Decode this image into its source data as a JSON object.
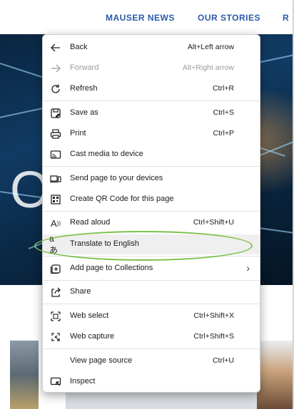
{
  "page": {
    "nav": [
      "MAUSER NEWS",
      "OUR STORIES",
      "R"
    ]
  },
  "menu": {
    "items": [
      {
        "label": "Back",
        "shortcut": "Alt+Left arrow",
        "icon": "arrow-left-icon"
      },
      {
        "label": "Forward",
        "shortcut": "Alt+Right arrow",
        "icon": "arrow-right-icon",
        "disabled": true
      },
      {
        "label": "Refresh",
        "shortcut": "Ctrl+R",
        "icon": "refresh-icon"
      },
      {
        "label": "Save as",
        "shortcut": "Ctrl+S",
        "icon": "save-icon"
      },
      {
        "label": "Print",
        "shortcut": "Ctrl+P",
        "icon": "print-icon"
      },
      {
        "label": "Cast media to device",
        "shortcut": "",
        "icon": "cast-icon"
      },
      {
        "label": "Send page to your devices",
        "shortcut": "",
        "icon": "devices-icon"
      },
      {
        "label": "Create QR Code for this page",
        "shortcut": "",
        "icon": "qr-code-icon"
      },
      {
        "label": "Read aloud",
        "shortcut": "Ctrl+Shift+U",
        "icon": "read-aloud-icon"
      },
      {
        "label": "Translate to English",
        "shortcut": "",
        "icon": "translate-icon"
      },
      {
        "label": "Add page to Collections",
        "shortcut": "",
        "icon": "collections-icon"
      },
      {
        "label": "Share",
        "shortcut": "",
        "icon": "share-icon"
      },
      {
        "label": "Web select",
        "shortcut": "Ctrl+Shift+X",
        "icon": "web-select-icon"
      },
      {
        "label": "Web capture",
        "shortcut": "Ctrl+Shift+S",
        "icon": "web-capture-icon"
      },
      {
        "label": "View page source",
        "shortcut": "Ctrl+U",
        "icon": ""
      },
      {
        "label": "Inspect",
        "shortcut": "",
        "icon": "inspect-icon"
      }
    ]
  },
  "highlight": {
    "color": "#7dc24a",
    "target": "Translate to English"
  }
}
